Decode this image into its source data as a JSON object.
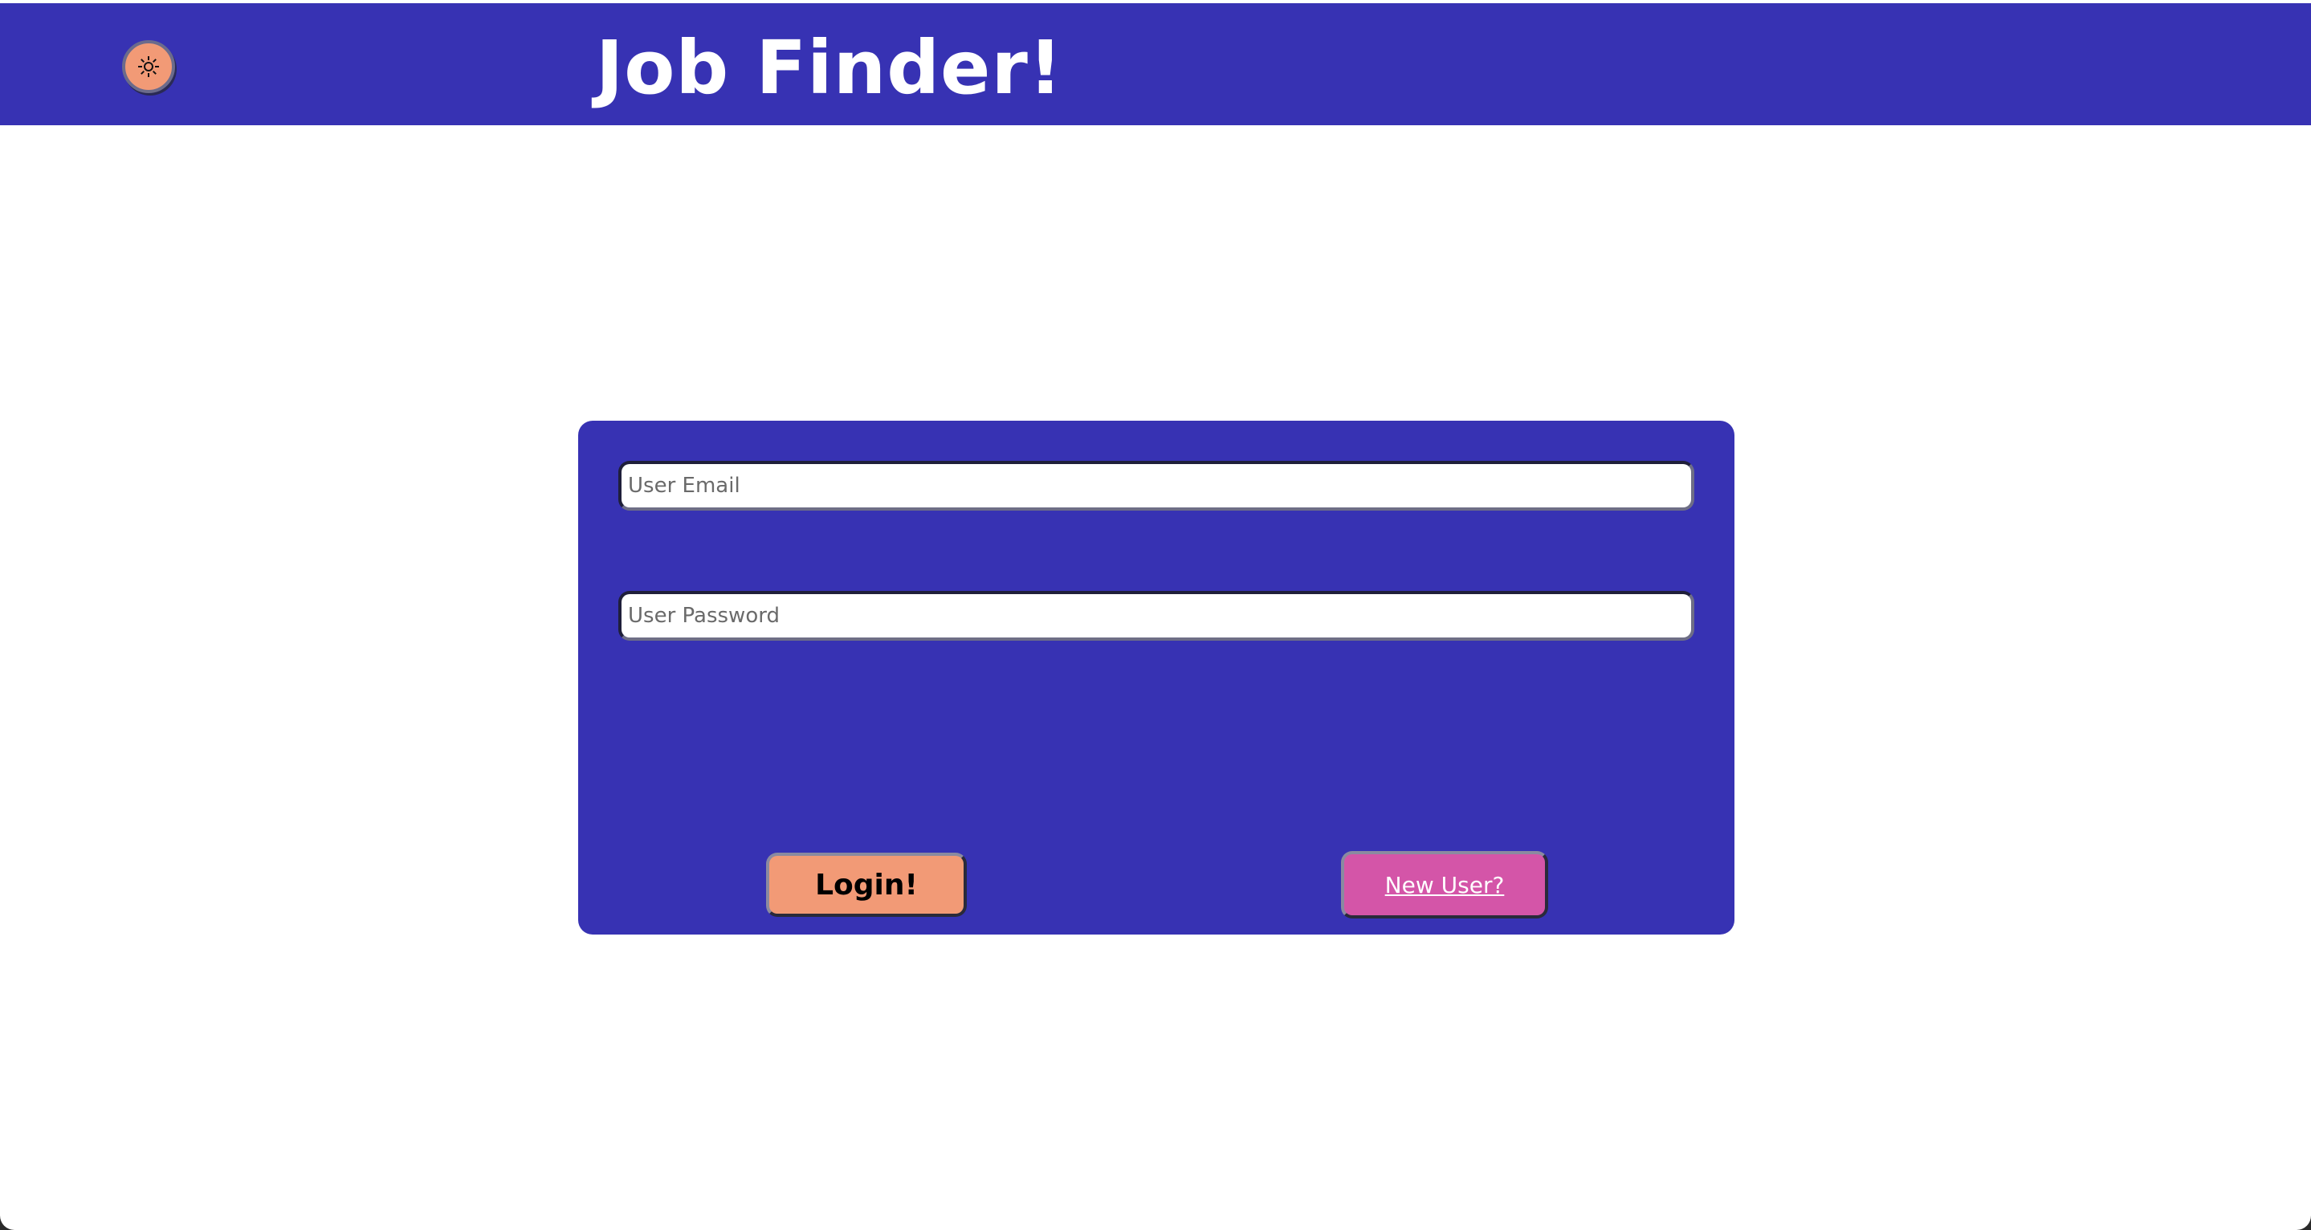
{
  "header": {
    "title": "Job Finder!",
    "theme_toggle_icon": "sun-icon"
  },
  "login_form": {
    "email_placeholder": "User Email",
    "password_placeholder": "User Password",
    "login_label": "Login!",
    "new_user_label": "New User?"
  },
  "colors": {
    "primary": "#3732b3",
    "login_button": "#f29a76",
    "new_user_button": "#d455a8",
    "background": "#ffffff"
  }
}
